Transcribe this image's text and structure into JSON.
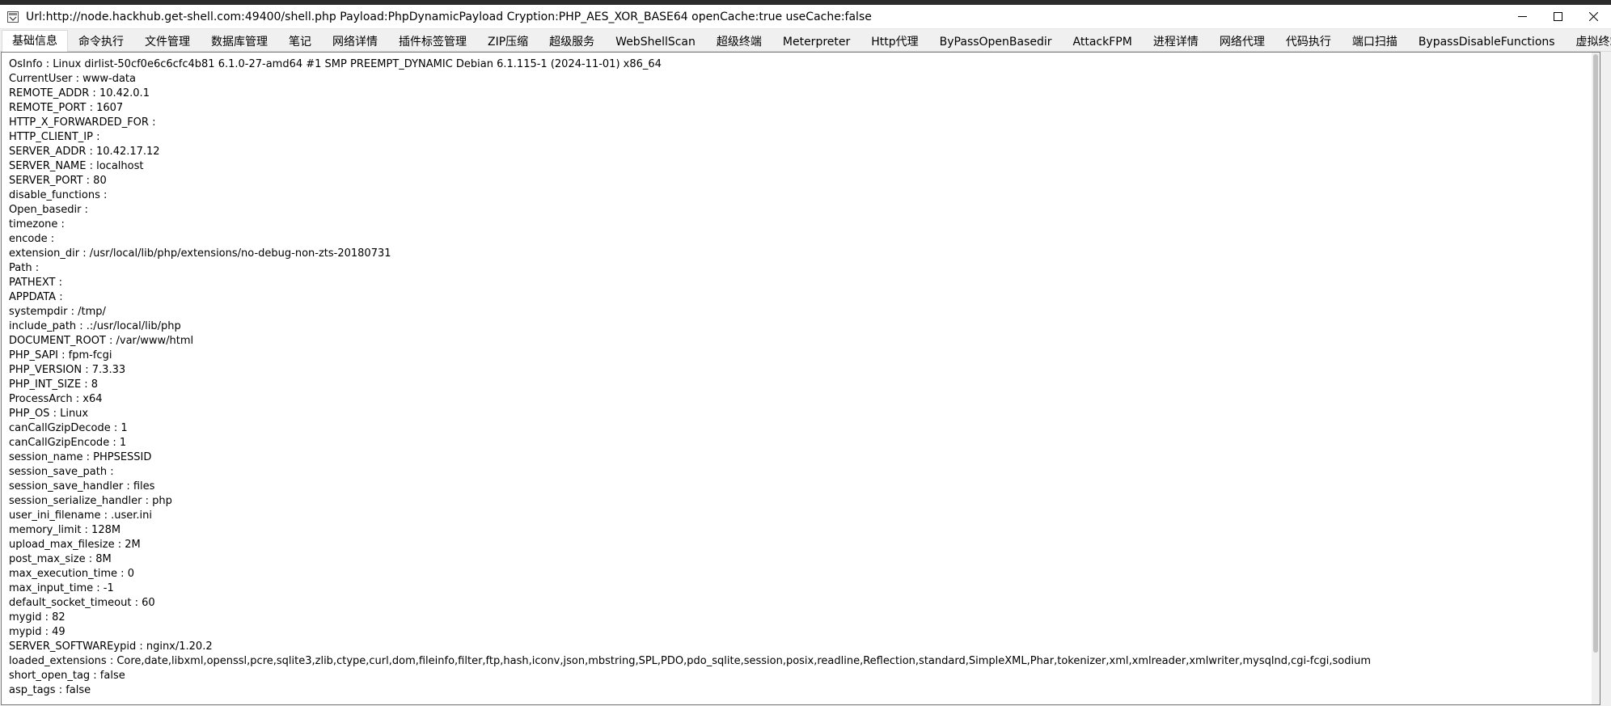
{
  "window": {
    "title": "Url:http://node.hackhub.get-shell.com:49400/shell.php Payload:PhpDynamicPayload Cryption:PHP_AES_XOR_BASE64 openCache:true useCache:false",
    "app_icon": "app-window-icon",
    "controls": {
      "minimize": "minimize-icon",
      "maximize": "maximize-icon",
      "close": "close-icon"
    }
  },
  "tabs": [
    {
      "label": "基础信息",
      "active": true
    },
    {
      "label": "命令执行"
    },
    {
      "label": "文件管理"
    },
    {
      "label": "数据库管理"
    },
    {
      "label": "笔记"
    },
    {
      "label": "网络详情"
    },
    {
      "label": "插件标签管理"
    },
    {
      "label": "ZIP压缩"
    },
    {
      "label": "超级服务"
    },
    {
      "label": "WebShellScan"
    },
    {
      "label": "超级终端"
    },
    {
      "label": "Meterpreter"
    },
    {
      "label": "Http代理"
    },
    {
      "label": "ByPassOpenBasedir"
    },
    {
      "label": "AttackFPM"
    },
    {
      "label": "进程详情"
    },
    {
      "label": "网络代理"
    },
    {
      "label": "代码执行"
    },
    {
      "label": "端口扫描"
    },
    {
      "label": "BypassDisableFunctions"
    },
    {
      "label": "虚拟终端"
    }
  ],
  "info_lines": [
    "OsInfo : Linux dirlist-50cf0e6c6cfc4b81 6.1.0-27-amd64 #1 SMP PREEMPT_DYNAMIC Debian 6.1.115-1 (2024-11-01) x86_64",
    "CurrentUser : www-data",
    "REMOTE_ADDR : 10.42.0.1",
    "REMOTE_PORT : 1607",
    "HTTP_X_FORWARDED_FOR :",
    "HTTP_CLIENT_IP :",
    "SERVER_ADDR : 10.42.17.12",
    "SERVER_NAME : localhost",
    "SERVER_PORT : 80",
    "disable_functions :",
    "Open_basedir :",
    "timezone :",
    "encode :",
    "extension_dir : /usr/local/lib/php/extensions/no-debug-non-zts-20180731",
    "Path :",
    "PATHEXT :",
    "APPDATA :",
    "systempdir : /tmp/",
    "include_path : .:/usr/local/lib/php",
    "DOCUMENT_ROOT : /var/www/html",
    "PHP_SAPI : fpm-fcgi",
    "PHP_VERSION : 7.3.33",
    "PHP_INT_SIZE : 8",
    "ProcessArch : x64",
    "PHP_OS : Linux",
    "canCallGzipDecode : 1",
    "canCallGzipEncode : 1",
    "session_name : PHPSESSID",
    "session_save_path :",
    "session_save_handler : files",
    "session_serialize_handler : php",
    "user_ini_filename : .user.ini",
    "memory_limit : 128M",
    "upload_max_filesize : 2M",
    "post_max_size : 8M",
    "max_execution_time : 0",
    "max_input_time : -1",
    "default_socket_timeout : 60",
    "mygid : 82",
    "mypid : 49",
    "SERVER_SOFTWAREypid : nginx/1.20.2",
    "loaded_extensions : Core,date,libxml,openssl,pcre,sqlite3,zlib,ctype,curl,dom,fileinfo,filter,ftp,hash,iconv,json,mbstring,SPL,PDO,pdo_sqlite,session,posix,readline,Reflection,standard,SimpleXML,Phar,tokenizer,xml,xmlreader,xmlwriter,mysqlnd,cgi-fcgi,sodium",
    "short_open_tag : false",
    "asp_tags : false"
  ]
}
